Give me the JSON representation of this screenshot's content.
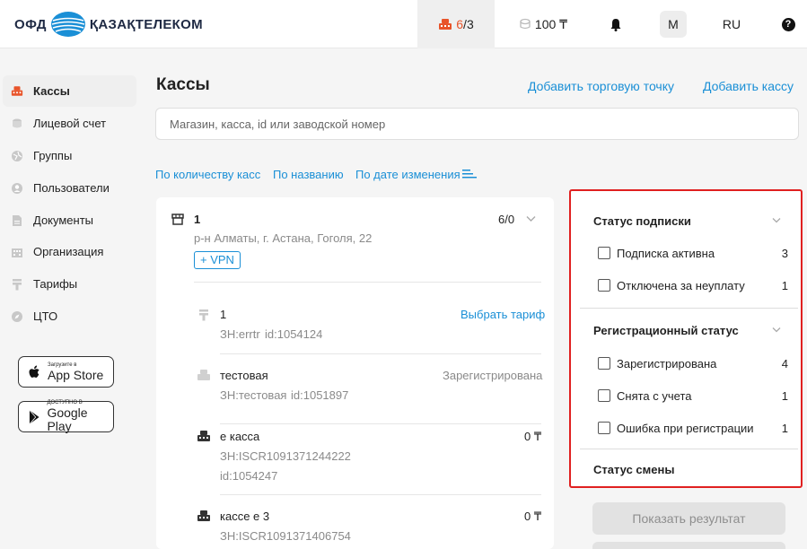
{
  "header": {
    "logo_left": "ОФД",
    "logo_right": "ҚАЗАҚТЕЛЕКОМ",
    "kassa_active": "6",
    "kassa_sep": "/",
    "kassa_total": "3",
    "balance": "100 ₸",
    "avatar": "M",
    "lang": "RU",
    "help": "?"
  },
  "sidebar": {
    "items": [
      {
        "label": "Кассы",
        "icon": "cash-register-icon",
        "active": true
      },
      {
        "label": "Лицевой счет",
        "icon": "coins-icon"
      },
      {
        "label": "Группы",
        "icon": "globe-icon"
      },
      {
        "label": "Пользователи",
        "icon": "user-icon"
      },
      {
        "label": "Документы",
        "icon": "document-icon"
      },
      {
        "label": "Организация",
        "icon": "building-icon"
      },
      {
        "label": "Тарифы",
        "icon": "tariff-icon"
      },
      {
        "label": "ЦТО",
        "icon": "compass-icon"
      }
    ],
    "appstore_small": "Загрузите в",
    "appstore_big": "App Store",
    "googleplay_small": "ДОСТУПНО В",
    "googleplay_big": "Google Play"
  },
  "main": {
    "title": "Кассы",
    "add_point": "Добавить торговую точку",
    "add_kassa": "Добавить кассу",
    "search_placeholder": "Магазин, касса, id или заводской номер",
    "sort": {
      "by_count": "По количеству касс",
      "by_name": "По названию",
      "by_date": "По дате изменения"
    }
  },
  "point": {
    "name": "1",
    "address": "р-н Алматы, г. Астана, Гоголя, 22",
    "count": "6/0",
    "vpn": "+ VPN",
    "kassas": [
      {
        "name": "1",
        "zn": "ЗН:errtr",
        "id": "id:1054124",
        "action": "Выбрать тариф"
      },
      {
        "name": "тестовая",
        "zn": "ЗН:тестовая",
        "id": "id:1051897",
        "status": "Зарегистрирована"
      },
      {
        "name": "е касса",
        "zn": "ЗН:ISCR1091371244222",
        "id": "id:1054247",
        "amount": "0 ₸"
      },
      {
        "name": "кассе е 3",
        "zn": "ЗН:ISCR1091371406754",
        "amount": "0 ₸"
      }
    ]
  },
  "filters": {
    "subscription": {
      "title": "Статус подписки",
      "options": [
        {
          "label": "Подписка активна",
          "count": "3"
        },
        {
          "label": "Отключена за неуплату",
          "count": "1"
        }
      ]
    },
    "registration": {
      "title": "Регистрационный статус",
      "options": [
        {
          "label": "Зарегистрирована",
          "count": "4"
        },
        {
          "label": "Снята с учета",
          "count": "1"
        },
        {
          "label": "Ошибка при регистрации",
          "count": "1"
        }
      ]
    },
    "shift": {
      "title": "Статус смены"
    },
    "show_button": "Показать результат"
  },
  "colors": {
    "accent": "#1a8fd6",
    "brand_orange": "#e8542a",
    "highlight_border": "#e02020"
  }
}
